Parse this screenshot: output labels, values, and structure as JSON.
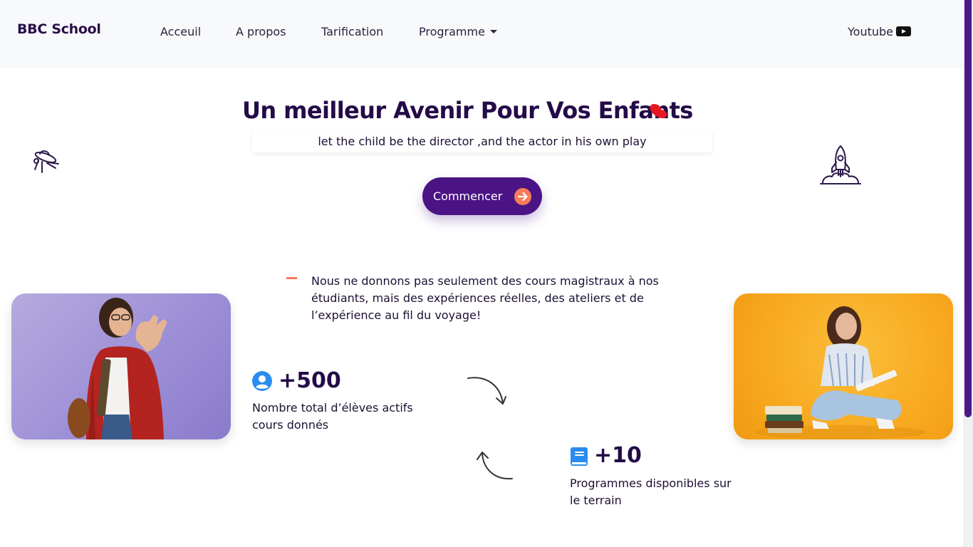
{
  "nav": {
    "brand": "BBC School",
    "links": [
      "Acceuil",
      "A propos",
      "Tarification",
      "Programme"
    ],
    "youtube_label": "Youtube"
  },
  "hero": {
    "title": "Un meilleur Avenir Pour Vos Enfants",
    "subtitle": "let the child be the director ,and the actor in his own play",
    "cta_label": "Commencer"
  },
  "about": {
    "description": "Nous ne donnons pas seulement des cours magistraux à nos étudiants, mais des expériences réelles, des ateliers et de l’expérience au fil du voyage!"
  },
  "stats": [
    {
      "value": "+500",
      "label": "Nombre total d’élèves actifs cours donnés",
      "icon": "user-circle-icon"
    },
    {
      "value": "+10",
      "label": "Programmes disponibles sur le terrain",
      "icon": "book-icon"
    }
  ],
  "colors": {
    "accent": "#4b1485",
    "secondary": "#f97c5a",
    "heading": "#240b48",
    "heart": "#e8171f",
    "stat_icon": "#2b8cf0"
  }
}
